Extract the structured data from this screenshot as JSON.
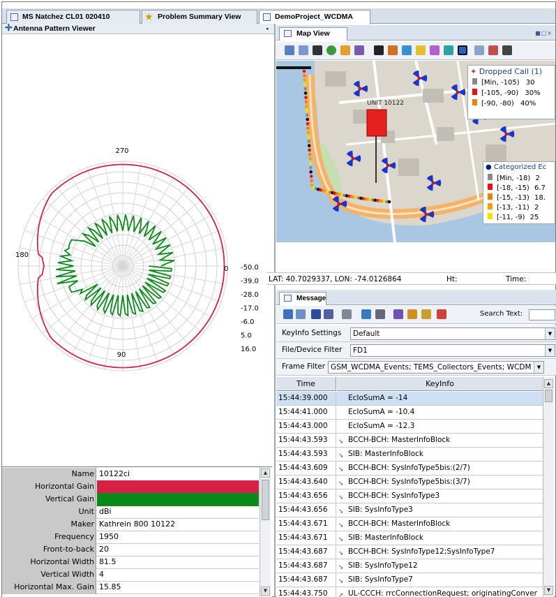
{
  "tabs": [
    {
      "label": "MS Natchez CL01 020410",
      "icon": "log-file-icon"
    },
    {
      "label": "Problem Summary View",
      "icon": "star-icon"
    },
    {
      "label": "DemoProject_WCDMA",
      "icon": "project-file-icon"
    }
  ],
  "antenna": {
    "title": "Antenna Pattern Viewer",
    "angle_labels": {
      "top": "270",
      "left": "180",
      "right": "0",
      "bottom": "90"
    },
    "radial_labels": [
      "-50.0",
      "-39.0",
      "-28.0",
      "-17.0",
      "-6.0",
      "5.0",
      "16.0"
    ],
    "colors": {
      "horizontal": "#d62045",
      "vertical": "#0b8a1a"
    }
  },
  "properties": [
    {
      "key": "Name",
      "value": "10122ci"
    },
    {
      "key": "Horizontal Gain",
      "value": ""
    },
    {
      "key": "Vertical Gain",
      "value": ""
    },
    {
      "key": "Unit",
      "value": "dBi"
    },
    {
      "key": "Maker",
      "value": "Kathrein 800 10122"
    },
    {
      "key": "Frequency",
      "value": "1950"
    },
    {
      "key": "Front-to-back",
      "value": "20"
    },
    {
      "key": "Horizontal Width",
      "value": "81.5"
    },
    {
      "key": "Vertical Width",
      "value": "4"
    },
    {
      "key": "Horizontal Max. Gain",
      "value": "15.85"
    }
  ],
  "map": {
    "title": "Map View",
    "legend1_title": "Dropped Call (1)",
    "legend1_items": [
      {
        "range": "[Min, -105)",
        "pct": "30"
      },
      {
        "range": "[-105, -90)",
        "pct": "30%"
      },
      {
        "range": "[-90, -80)",
        "pct": "40%"
      }
    ],
    "legend2_title": "Categorized Ec",
    "legend2_items": [
      {
        "range": "[Min, -18)",
        "pct": "2"
      },
      {
        "range": "[-18, -15)",
        "pct": "6.7"
      },
      {
        "range": "[-15, -13)",
        "pct": "18."
      },
      {
        "range": "[-13, -11)",
        "pct": "2"
      },
      {
        "range": "[-11, -9)",
        "pct": "25"
      }
    ],
    "building_label": "UNIT 10122",
    "coords": "LAT: 40.7029337, LON: -74.0126864",
    "ht_label": "Ht:",
    "time_label": "Time:"
  },
  "message": {
    "title": "Message",
    "search_label": "Search Text:",
    "keyinfo_label": "KeyInfo Settings",
    "keyinfo_value": "Default",
    "filter_label": "File/Device Filter",
    "filter_value": "FD1",
    "frame_label": "Frame Filter",
    "frame_value": "GSM_WCDMA_Events; TEMS_Collectors_Events; WCDM",
    "col_time": "Time",
    "col_key": "KeyInfo",
    "rows": [
      {
        "time": "15:44:39.000",
        "key": "EcIoSumA = -14",
        "arrow": ""
      },
      {
        "time": "15:44:41.000",
        "key": "EcIoSumA = -10.4",
        "arrow": ""
      },
      {
        "time": "15:44:43.000",
        "key": "EcIoSumA = -12.3",
        "arrow": ""
      },
      {
        "time": "15:44:43.593",
        "key": "BCCH-BCH: MasterInfoBlock",
        "arrow": "➘"
      },
      {
        "time": "15:44:43.593",
        "key": "SIB: MasterInfoBlock",
        "arrow": "➘"
      },
      {
        "time": "15:44:43.609",
        "key": "BCCH-BCH: SysInfoType5bis:(2/7)",
        "arrow": "➘"
      },
      {
        "time": "15:44:43.640",
        "key": "BCCH-BCH: SysInfoType5bis:(3/7)",
        "arrow": "➘"
      },
      {
        "time": "15:44:43.656",
        "key": "BCCH-BCH: SysInfoType3",
        "arrow": "➘"
      },
      {
        "time": "15:44:43.656",
        "key": "SIB: SysInfoType3",
        "arrow": "➘"
      },
      {
        "time": "15:44:43.671",
        "key": "BCCH-BCH: MasterInfoBlock",
        "arrow": "➘"
      },
      {
        "time": "15:44:43.671",
        "key": "SIB: MasterInfoBlock",
        "arrow": "➘"
      },
      {
        "time": "15:44:43.687",
        "key": "BCCH-BCH: SysInfoType12;SysInfoType7",
        "arrow": "➘"
      },
      {
        "time": "15:44:43.687",
        "key": "SIB: SysInfoType12",
        "arrow": "➘"
      },
      {
        "time": "15:44:43.687",
        "key": "SIB: SysInfoType7",
        "arrow": "➘"
      },
      {
        "time": "15:44:43.750",
        "key": "UL-CCCH: rrcConnectionRequest; originatingConver",
        "arrow": "➚"
      }
    ]
  }
}
